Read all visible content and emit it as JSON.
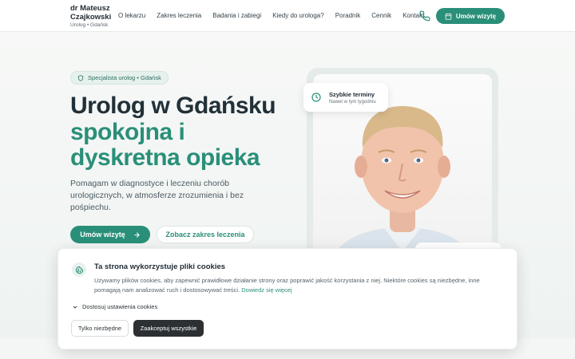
{
  "brand": {
    "name_line1": "dr Mateusz",
    "name_line2": "Czajkowski",
    "subtitle": "Urolog • Gdańsk"
  },
  "nav": {
    "items": [
      "O lekarzu",
      "Zakres leczenia",
      "Badania i zabiegi",
      "Kiedy do urologa?",
      "Poradnik",
      "Cennik",
      "Kontakt"
    ],
    "phone_icon": "phone-icon",
    "cta_label": "Umów wizytę",
    "cta_icon": "calendar-icon"
  },
  "hero": {
    "badge": "Specjalista urolog • Gdańsk",
    "badge_icon": "shield-icon",
    "title_line1": "Urolog w Gdańsku",
    "title_line2": "spokojna i dyskretna opieka",
    "lead": "Pomagam w diagnostyce i leczeniu chorób urologicznych, w atmosferze zrozumienia i bez pośpiechu.",
    "primary_button": "Umów wizytę",
    "primary_button_icon": "arrow-right-icon",
    "secondary_button": "Zobacz zakres leczenia"
  },
  "floating_badge": {
    "title": "Szybkie terminy",
    "subtitle": "Nawet w tym tygodniu",
    "icon": "clock-icon"
  },
  "cookie": {
    "title": "Ta strona wykorzystuje pliki cookies",
    "text": "Używamy plików cookies, aby zapewnić prawidłowe działanie strony oraz poprawić jakość korzystania z niej. Niektóre cookies są niezbędne, inne pomagają nam analizować ruch i dostosowywać treści.",
    "more_link": "Dowiedz się więcej",
    "settings_label": "Dostosuj ustawienia cookies",
    "necessary_button": "Tylko niezbędne",
    "accept_button": "Zaakceptuj wszystkie",
    "icon": "cookie-icon"
  },
  "colors": {
    "accent": "#2a8f79",
    "dark": "#223038",
    "dark_button": "#2c3033"
  }
}
